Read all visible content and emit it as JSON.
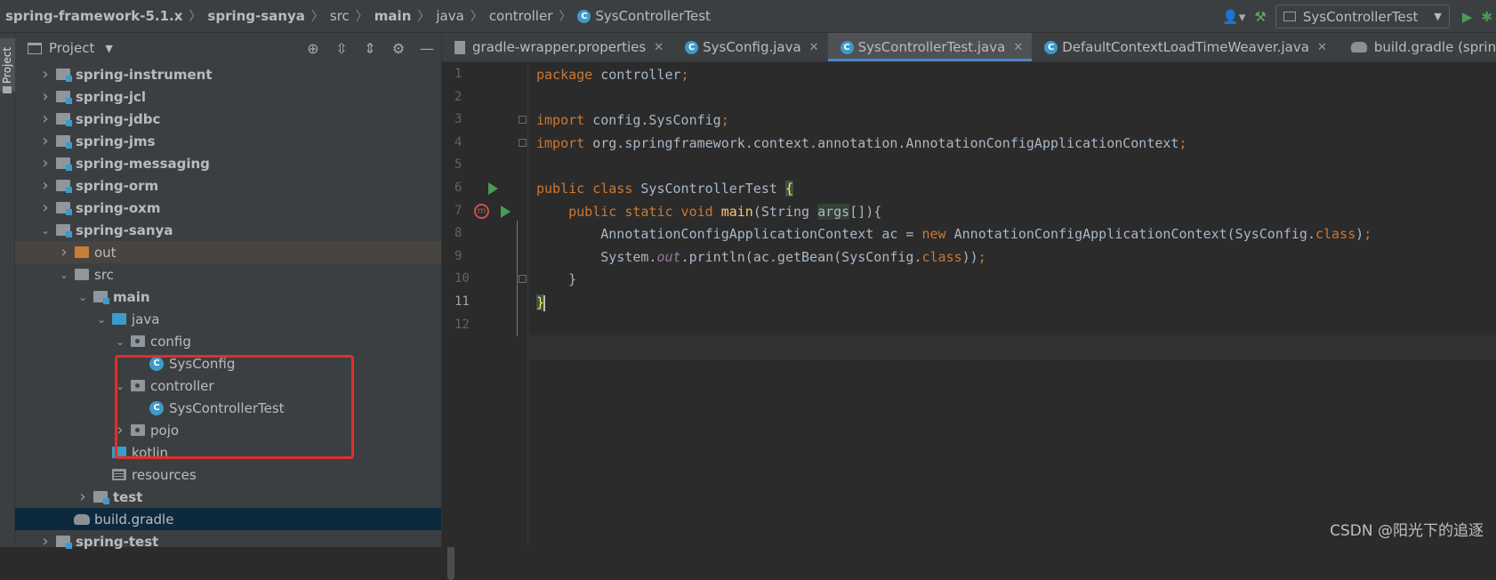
{
  "breadcrumbs": [
    "spring-framework-5.1.x",
    "spring-sanya",
    "src",
    "main",
    "java",
    "controller",
    "SysControllerTest"
  ],
  "run_config": {
    "label": "SysControllerTest"
  },
  "toolwindow": {
    "label": "Project"
  },
  "project_panel": {
    "title": "Project",
    "tree": [
      {
        "label": "spring-instrument",
        "depth": 0,
        "expand": "collapsed",
        "icon": "module",
        "bold": true
      },
      {
        "label": "spring-jcl",
        "depth": 0,
        "expand": "collapsed",
        "icon": "module",
        "bold": true
      },
      {
        "label": "spring-jdbc",
        "depth": 0,
        "expand": "collapsed",
        "icon": "module",
        "bold": true
      },
      {
        "label": "spring-jms",
        "depth": 0,
        "expand": "collapsed",
        "icon": "module",
        "bold": true
      },
      {
        "label": "spring-messaging",
        "depth": 0,
        "expand": "collapsed",
        "icon": "module",
        "bold": true
      },
      {
        "label": "spring-orm",
        "depth": 0,
        "expand": "collapsed",
        "icon": "module",
        "bold": true
      },
      {
        "label": "spring-oxm",
        "depth": 0,
        "expand": "collapsed",
        "icon": "module",
        "bold": true
      },
      {
        "label": "spring-sanya",
        "depth": 0,
        "expand": "expanded",
        "icon": "module",
        "bold": true
      },
      {
        "label": "out",
        "depth": 1,
        "expand": "collapsed",
        "icon": "orange-folder",
        "bold": false,
        "state": "excluded"
      },
      {
        "label": "src",
        "depth": 1,
        "expand": "expanded",
        "icon": "folder",
        "bold": false
      },
      {
        "label": "main",
        "depth": 2,
        "expand": "expanded",
        "icon": "module",
        "bold": true
      },
      {
        "label": "java",
        "depth": 3,
        "expand": "expanded",
        "icon": "source-folder",
        "bold": false
      },
      {
        "label": "config",
        "depth": 4,
        "expand": "expanded",
        "icon": "package",
        "bold": false
      },
      {
        "label": "SysConfig",
        "depth": 5,
        "expand": "none",
        "icon": "class",
        "bold": false
      },
      {
        "label": "controller",
        "depth": 4,
        "expand": "expanded",
        "icon": "package",
        "bold": false
      },
      {
        "label": "SysControllerTest",
        "depth": 5,
        "expand": "none",
        "icon": "class",
        "bold": false
      },
      {
        "label": "pojo",
        "depth": 4,
        "expand": "collapsed",
        "icon": "package",
        "bold": false
      },
      {
        "label": "kotlin",
        "depth": 3,
        "expand": "none",
        "icon": "source-folder",
        "bold": false
      },
      {
        "label": "resources",
        "depth": 3,
        "expand": "none",
        "icon": "resources-folder",
        "bold": false
      },
      {
        "label": "test",
        "depth": 2,
        "expand": "collapsed",
        "icon": "module",
        "bold": true
      },
      {
        "label": "build.gradle",
        "depth": 1,
        "expand": "none",
        "icon": "gradle",
        "bold": false,
        "state": "selected"
      },
      {
        "label": "spring-test",
        "depth": 0,
        "expand": "collapsed",
        "icon": "module",
        "bold": true
      }
    ]
  },
  "tabs": [
    {
      "label": "gradle-wrapper.properties",
      "icon": "properties-icon",
      "active": false
    },
    {
      "label": "SysConfig.java",
      "icon": "class-icon",
      "active": false
    },
    {
      "label": "SysControllerTest.java",
      "icon": "class-icon",
      "active": true
    },
    {
      "label": "DefaultContextLoadTimeWeaver.java",
      "icon": "class-icon",
      "active": false
    },
    {
      "label": "build.gradle (spring)",
      "icon": "gradle-icon",
      "active": false
    }
  ],
  "editor": {
    "line_numbers": [
      "1",
      "2",
      "3",
      "4",
      "5",
      "6",
      "7",
      "8",
      "9",
      "10",
      "11",
      "12"
    ],
    "current_line": 11,
    "code": [
      [
        {
          "t": "package ",
          "c": "kw"
        },
        {
          "t": "controller",
          "c": ""
        },
        {
          "t": ";",
          "c": "kw"
        }
      ],
      [],
      [
        {
          "t": "import ",
          "c": "kw"
        },
        {
          "t": "config.SysConfig",
          "c": ""
        },
        {
          "t": ";",
          "c": "kw"
        }
      ],
      [
        {
          "t": "import ",
          "c": "kw"
        },
        {
          "t": "org.springframework.context.annotation.AnnotationConfigApplicationContext",
          "c": ""
        },
        {
          "t": ";",
          "c": "kw"
        }
      ],
      [],
      [
        {
          "t": "public class ",
          "c": "kw"
        },
        {
          "t": "SysControllerTest ",
          "c": ""
        },
        {
          "t": "{",
          "c": "brace-hl"
        }
      ],
      [
        {
          "t": "    public static void ",
          "c": "kw"
        },
        {
          "t": "main",
          "c": "fn"
        },
        {
          "t": "(String ",
          "c": ""
        },
        {
          "t": "args",
          "c": "param"
        },
        {
          "t": "[]){",
          "c": ""
        }
      ],
      [
        {
          "t": "        AnnotationConfigApplicationContext ac = ",
          "c": ""
        },
        {
          "t": "new ",
          "c": "kw"
        },
        {
          "t": "AnnotationConfigApplicationContext(SysConfig.",
          "c": ""
        },
        {
          "t": "class",
          "c": "kw"
        },
        {
          "t": ")",
          "c": ""
        },
        {
          "t": ";",
          "c": "kw"
        }
      ],
      [
        {
          "t": "        System.",
          "c": ""
        },
        {
          "t": "out",
          "c": "it"
        },
        {
          "t": ".println(ac.getBean(SysConfig.",
          "c": ""
        },
        {
          "t": "class",
          "c": "kw"
        },
        {
          "t": "))",
          "c": ""
        },
        {
          "t": ";",
          "c": "kw"
        }
      ],
      [
        {
          "t": "    }",
          "c": ""
        }
      ],
      [
        {
          "t": "}",
          "c": "brace-hl"
        }
      ],
      []
    ]
  },
  "watermark": "CSDN @阳光下的追逐"
}
